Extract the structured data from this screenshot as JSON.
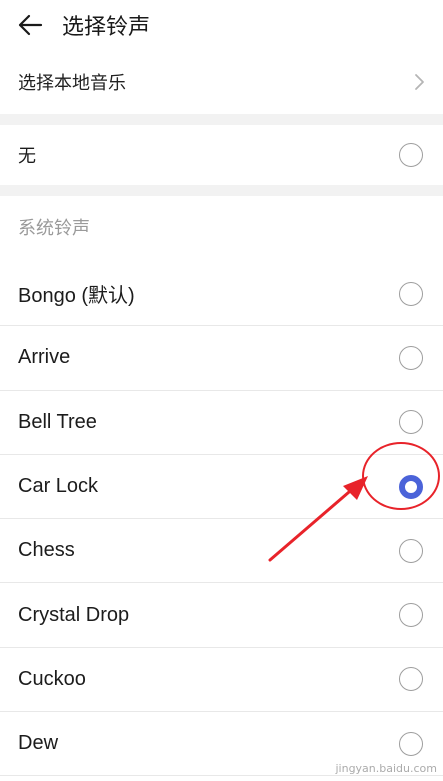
{
  "header": {
    "title": "选择铃声",
    "back_icon": "arrow-left-icon"
  },
  "local_music": {
    "label": "选择本地音乐",
    "icon": "chevron-right-icon"
  },
  "none_option": {
    "label": "无",
    "selected": false
  },
  "system": {
    "title": "系统铃声",
    "items": [
      {
        "label": "Bongo (默认)",
        "selected": false
      },
      {
        "label": "Arrive",
        "selected": false
      },
      {
        "label": "Bell Tree",
        "selected": false
      },
      {
        "label": "Car Lock",
        "selected": true
      },
      {
        "label": "Chess",
        "selected": false
      },
      {
        "label": "Crystal Drop",
        "selected": false
      },
      {
        "label": "Cuckoo",
        "selected": false
      },
      {
        "label": "Dew",
        "selected": false
      }
    ]
  },
  "colors": {
    "accent": "#4b63d9",
    "annotation": "#e8232a"
  },
  "watermark": {
    "text": "jingyan.baidu.com"
  }
}
